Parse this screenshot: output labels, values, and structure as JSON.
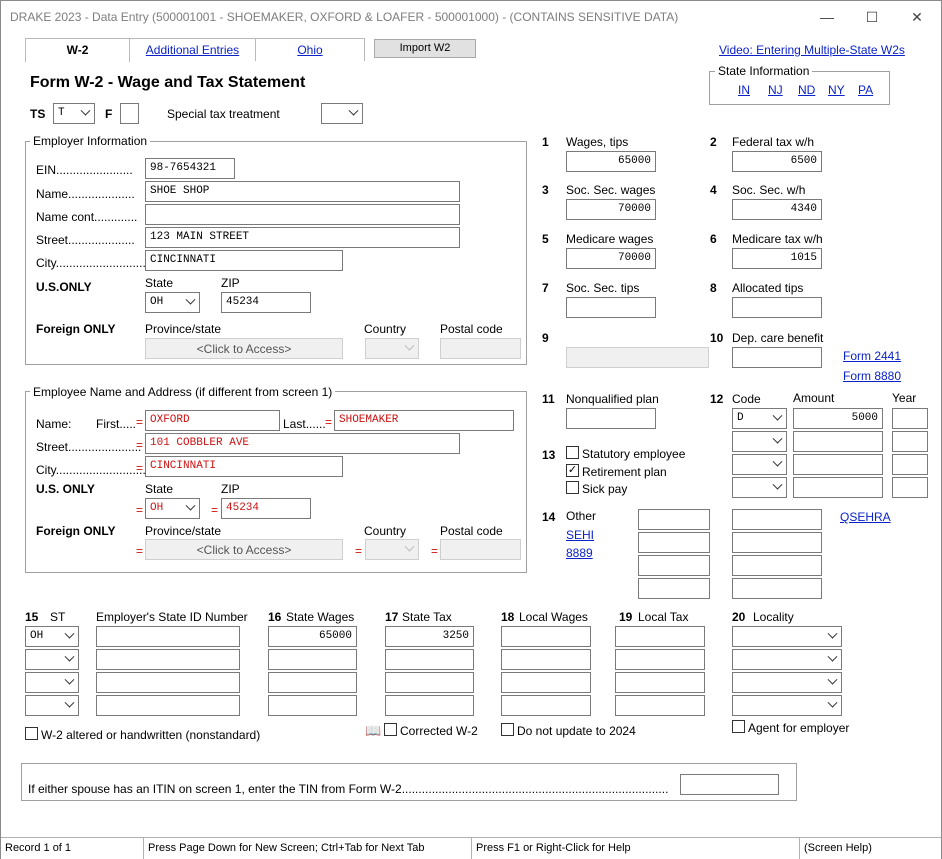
{
  "window": {
    "title": "DRAKE 2023 - Data Entry (500001001 - SHOEMAKER, OXFORD & LOAFER - 500001000) - (CONTAINS SENSITIVE DATA)",
    "minimize": "—",
    "maximize": "☐",
    "close": "✕"
  },
  "tabs": {
    "w2": "W-2",
    "additional": "Additional Entries",
    "ohio": "Ohio",
    "import": "Import W2",
    "video": "Video: Entering Multiple-State W2s"
  },
  "form_title": "Form W-2 - Wage and Tax Statement",
  "ts": {
    "label": "TS",
    "value": "T",
    "f_label": "F",
    "special_label": "Special tax treatment",
    "special_value": ""
  },
  "state_info": {
    "legend": "State Information",
    "links": [
      "IN",
      "NJ",
      "ND",
      "NY",
      "PA"
    ]
  },
  "employer": {
    "legend": "Employer Information",
    "ein_label": "EIN",
    "ein": "98-7654321",
    "name_label": "Name",
    "name": "SHOE SHOP",
    "name_cont_label": "Name cont.",
    "name_cont": "",
    "street_label": "Street",
    "street": "123 MAIN STREET",
    "city_label": "City",
    "city": "CINCINNATI",
    "us_only": "U.S.ONLY",
    "state_label": "State",
    "state": "OH",
    "zip_label": "ZIP",
    "zip": "45234",
    "foreign_only": "Foreign ONLY",
    "province_label": "Province/state",
    "province": "<Click to Access>",
    "country_label": "Country",
    "postal_label": "Postal code"
  },
  "employee": {
    "legend": "Employee Name and Address (if different from screen 1)",
    "name_label": "Name:",
    "first_label": "First",
    "first": "OXFORD",
    "last_label": "Last",
    "last": "SHOEMAKER",
    "street_label": "Street",
    "street": "101 COBBLER AVE",
    "city_label": "City",
    "city": "CINCINNATI",
    "us_only": "U.S. ONLY",
    "state_label": "State",
    "state": "OH",
    "zip_label": "ZIP",
    "zip": "45234",
    "foreign_only": "Foreign ONLY",
    "province_label": "Province/state",
    "province": "<Click to Access>",
    "country_label": "Country",
    "postal_label": "Postal code",
    "eq": "="
  },
  "boxes": {
    "b1": {
      "num": "1",
      "label": "Wages, tips",
      "value": "65000"
    },
    "b2": {
      "num": "2",
      "label": "Federal tax w/h",
      "value": "6500"
    },
    "b3": {
      "num": "3",
      "label": "Soc. Sec. wages",
      "value": "70000"
    },
    "b4": {
      "num": "4",
      "label": "Soc. Sec. w/h",
      "value": "4340"
    },
    "b5": {
      "num": "5",
      "label": "Medicare wages",
      "value": "70000"
    },
    "b6": {
      "num": "6",
      "label": "Medicare tax w/h",
      "value": "1015"
    },
    "b7": {
      "num": "7",
      "label": "Soc. Sec. tips",
      "value": ""
    },
    "b8": {
      "num": "8",
      "label": "Allocated tips",
      "value": ""
    },
    "b9": {
      "num": "9"
    },
    "b10": {
      "num": "10",
      "label": "Dep. care benefit",
      "value": "",
      "link1": "Form 2441",
      "link2": "Form 8880"
    },
    "b11": {
      "num": "11",
      "label": "Nonqualified  plan",
      "value": ""
    },
    "b12": {
      "num": "12",
      "code_label": "Code",
      "amount_label": "Amount",
      "year_label": "Year",
      "code1": "D",
      "amount1": "5000"
    },
    "b13": {
      "num": "13",
      "statutory": "Statutory employee",
      "retirement": "Retirement plan",
      "sick": "Sick pay",
      "check": "✓"
    },
    "b14": {
      "num": "14",
      "label": "Other",
      "sehi": "SEHI",
      "f8889": "8889",
      "qsehra": "QSEHRA"
    }
  },
  "state_table": {
    "col15_num": "15",
    "col15": "ST",
    "col_id": "Employer's State ID Number",
    "col16_num": "16",
    "col16": "State Wages",
    "col17_num": "17",
    "col17": "State Tax",
    "col18_num": "18",
    "col18": "Local Wages",
    "col19_num": "19",
    "col19": "Local Tax",
    "col20_num": "20",
    "col20": "Locality",
    "row1_st": "OH",
    "row1_wages": "65000",
    "row1_tax": "3250"
  },
  "checks": {
    "altered": "W-2 altered or handwritten (nonstandard)",
    "book": "📖",
    "corrected": "Corrected W-2",
    "no_update": "Do not update to 2024",
    "agent": "Agent for employer"
  },
  "itin": {
    "text": "If either spouse has an ITIN on screen 1, enter the TIN from Form W-2....................................................................................."
  },
  "status": {
    "record": "Record 1 of 1",
    "nav": "Press Page Down for New Screen; Ctrl+Tab for Next Tab",
    "help": "Press F1 or Right-Click for Help",
    "screen_help": "(Screen Help)"
  }
}
